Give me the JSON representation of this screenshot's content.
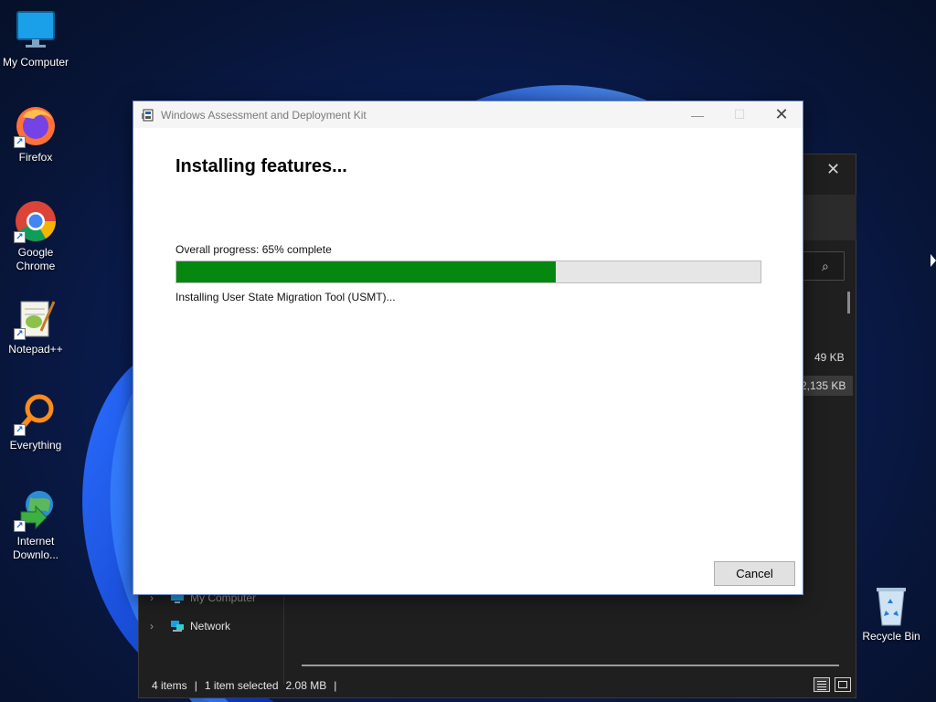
{
  "desktop": {
    "icons": [
      {
        "label": "My Computer",
        "icon": "monitor-icon",
        "shortcut": false
      },
      {
        "label": "Firefox",
        "icon": "firefox-icon",
        "shortcut": true
      },
      {
        "label": "Google Chrome",
        "icon": "chrome-icon",
        "shortcut": true
      },
      {
        "label": "Notepad++",
        "icon": "notepadpp-icon",
        "shortcut": true
      },
      {
        "label": "Everything",
        "icon": "search-magnifier-icon",
        "shortcut": true
      },
      {
        "label": "Internet Downlo...",
        "icon": "globe-download-icon",
        "shortcut": true
      },
      {
        "label": "Recycle Bin",
        "icon": "recycle-bin-icon",
        "shortcut": false
      }
    ],
    "shortcut_glyph": "↗"
  },
  "explorer": {
    "close_glyph": "✕",
    "search_glyph": "⌕",
    "file_sizes": [
      "49 KB",
      "2,135 KB"
    ],
    "nav_items": [
      {
        "label": "My Computer",
        "icon": "monitor-icon"
      },
      {
        "label": "Network",
        "icon": "network-icon"
      }
    ],
    "status": {
      "items": "4 items",
      "selected": "1 item selected",
      "size": "2.08 MB",
      "separator": "|"
    }
  },
  "dialog": {
    "title": "Windows Assessment and Deployment Kit",
    "minimize_glyph": "—",
    "maximize_glyph": "☐",
    "close_glyph": "✕",
    "heading": "Installing features...",
    "progress_label": "Overall progress: 65% complete",
    "progress_fraction": 0.65,
    "status_text": "Installing User State Migration Tool (USMT)...",
    "cancel_label": "Cancel",
    "progress_color": "#06870f"
  }
}
